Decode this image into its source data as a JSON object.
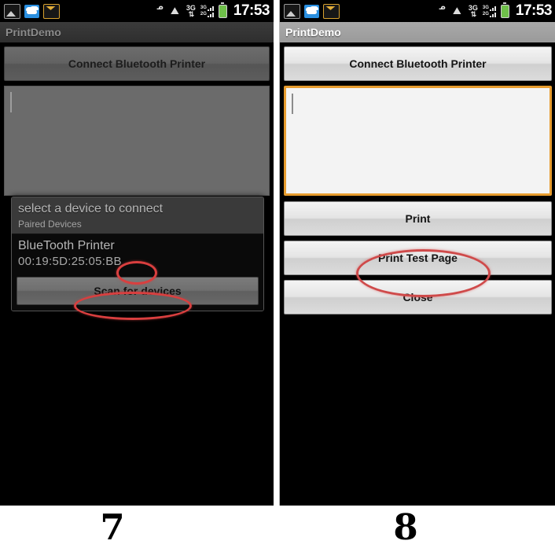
{
  "figure": {
    "panels": [
      {
        "caption": "7"
      },
      {
        "caption": "8"
      }
    ]
  },
  "colors": {
    "accent_focus": "#e79c2e",
    "annotation": "#d93f3f",
    "battery": "#6fc04a",
    "cloud_icon": "#2a8fe0",
    "mail_icon": "#e3ae3a",
    "screen_bg": "#000000"
  },
  "status_bar": {
    "clock": "17:53",
    "left_icons": [
      {
        "name": "gallery-icon",
        "label": "Gallery"
      },
      {
        "name": "cloud-icon",
        "label": "Cloud"
      },
      {
        "name": "mail-icon",
        "label": "Mail"
      }
    ],
    "right_icons": [
      {
        "name": "bluetooth-icon",
        "glyph": "ᛒ"
      },
      {
        "name": "sync-icon",
        "glyph": "↑"
      },
      {
        "name": "network-3g-icon",
        "label": "3G",
        "arrows": "↑↓"
      },
      {
        "name": "signal-bars-icon",
        "labels": [
          "3G",
          "2G"
        ]
      },
      {
        "name": "battery-icon",
        "label": "Battery"
      }
    ]
  },
  "left_phone": {
    "title": "PrintDemo",
    "connect_button": "Connect Bluetooth Printer",
    "textarea_value": "",
    "dialog": {
      "title": "select a device to connect",
      "subtitle": "Paired Devices",
      "devices": [
        {
          "name": "BlueTooth Printer",
          "address": "00:19:5D:25:05:BB"
        }
      ],
      "scan_button": "Scan for devices"
    }
  },
  "right_phone": {
    "title": "PrintDemo",
    "connect_button": "Connect Bluetooth Printer",
    "textarea_value": "",
    "buttons": [
      {
        "label": "Print"
      },
      {
        "label": "Print Test Page"
      },
      {
        "label": "Close"
      }
    ]
  }
}
